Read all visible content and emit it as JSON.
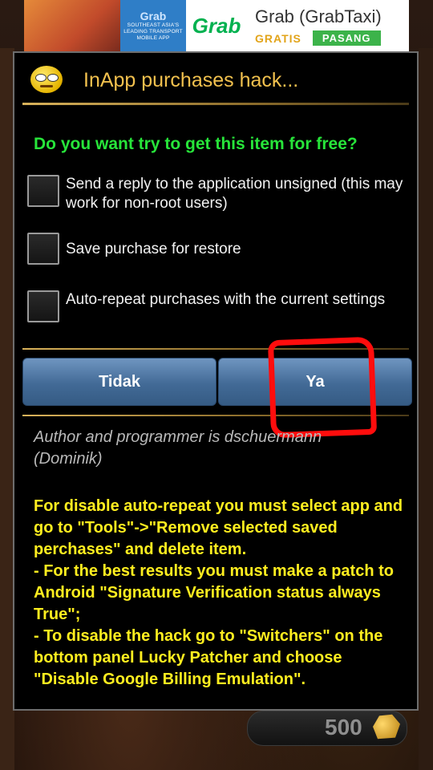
{
  "ad": {
    "promo_brand": "Grab",
    "promo_tagline": "SOUTHEAST ASIA'S LEADING TRANSPORT MOBILE APP",
    "logo_text": "Grab",
    "app_title": "Grab (GrabTaxi)",
    "price": "GRATIS",
    "install_label": "PASANG"
  },
  "dialog": {
    "title": "InApp purchases hack...",
    "question": "Do you want try to get this item for free?",
    "options": [
      {
        "label": "Send a reply to the application unsigned (this may work for non-root users)"
      },
      {
        "label": "Save purchase for restore"
      },
      {
        "label": "Auto-repeat purchases with the current settings"
      }
    ],
    "buttons": {
      "no": "Tidak",
      "yes": "Ya"
    },
    "author": "Author and programmer is dschuermann (Dominik)",
    "notes": "For disable auto-repeat you must select app and go to \"Tools\"->\"Remove selected saved perchases\" and delete item.\n- For the best results you must make a patch to Android \"Signature Verification status always True\";\n- To disable the hack go to \"Switchers\" on the bottom panel Lucky Patcher and choose \"Disable Google Billing Emulation\"."
  },
  "game": {
    "coins": "500"
  },
  "colors": {
    "title": "#f2c14e",
    "question": "#27e53a",
    "notes": "#ffee1f",
    "button": "#426a96",
    "annotation": "#ff0d0d"
  }
}
